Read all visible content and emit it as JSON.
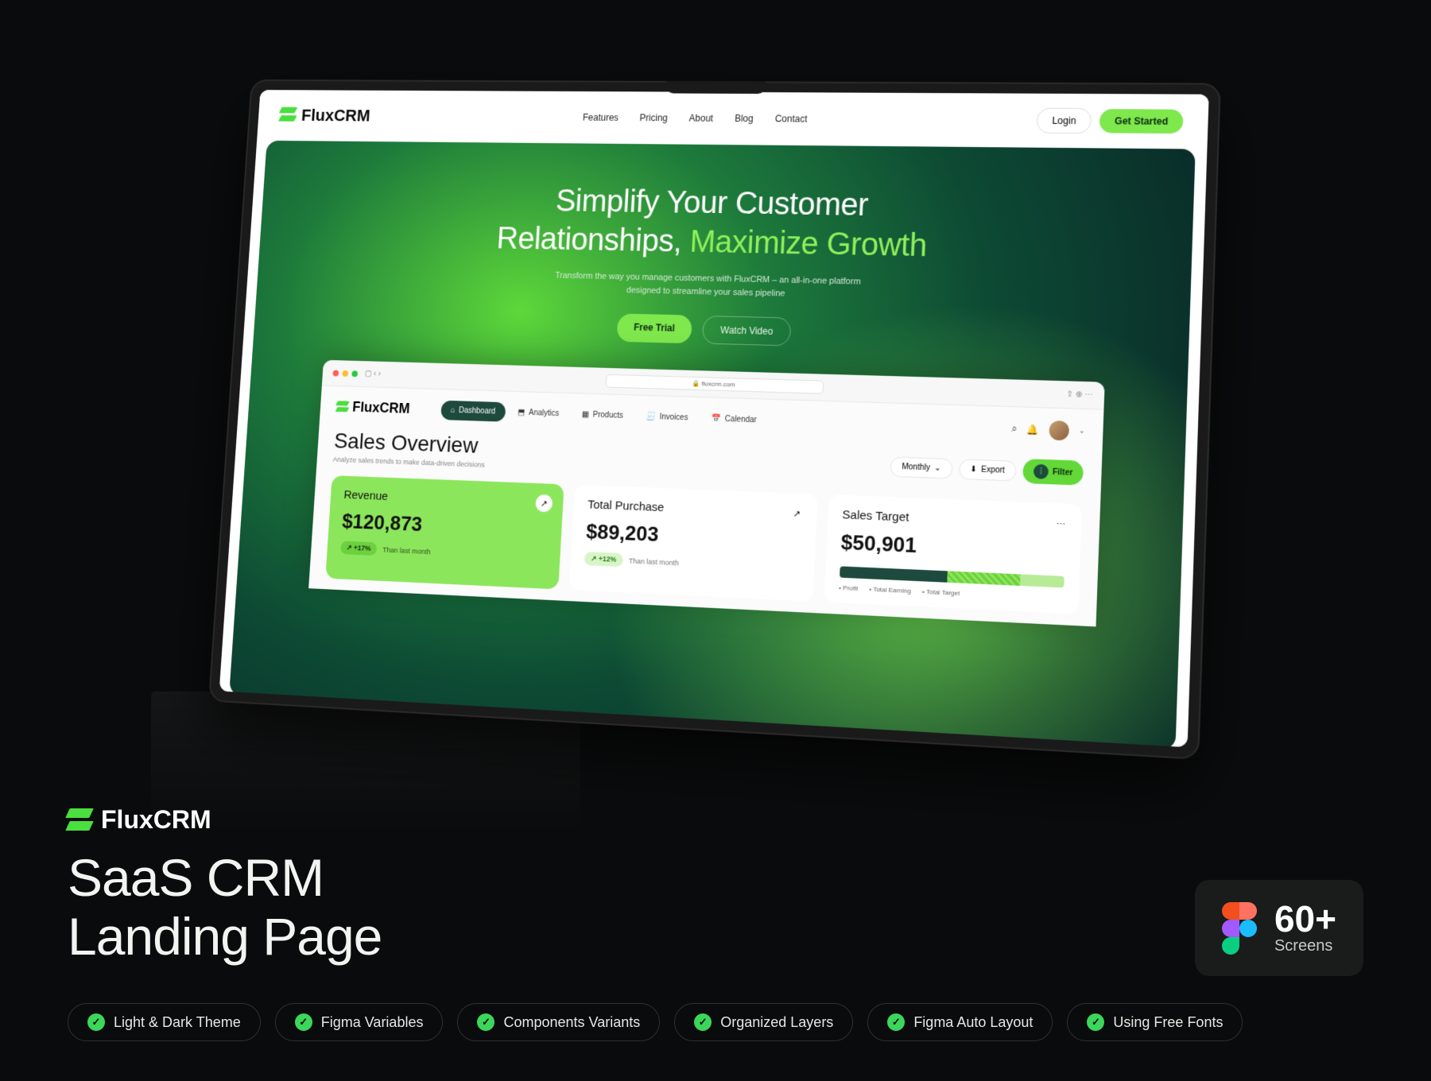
{
  "brand": "FluxCRM",
  "nav": {
    "links": [
      "Features",
      "Pricing",
      "About",
      "Blog",
      "Contact"
    ],
    "login": "Login",
    "cta": "Get Started"
  },
  "hero": {
    "title_a": "Simplify Your Customer",
    "title_b": "Relationships, ",
    "title_accent": "Maximize Growth",
    "subtitle": "Transform the way you manage customers with FluxCRM – an all-in-one platform\ndesigned to streamline your sales pipeline",
    "cta_primary": "Free Trial",
    "cta_secondary": "Watch Video"
  },
  "browser": {
    "url": "fluxcrm.com"
  },
  "dashboard": {
    "nav": [
      "Dashboard",
      "Analytics",
      "Products",
      "Invoices",
      "Calendar"
    ],
    "title": "Sales Overview",
    "subtitle": "Analyze sales trends to make data-driven decisions",
    "period": "Monthly",
    "export": "Export",
    "filter": "Filter",
    "cards": {
      "revenue": {
        "label": "Revenue",
        "value": "$120,873",
        "delta": "+17%",
        "note": "Than last month"
      },
      "purchase": {
        "label": "Total Purchase",
        "value": "$89,203",
        "delta": "+12%",
        "note": "Than last month"
      },
      "target": {
        "label": "Sales Target",
        "value": "$50,901",
        "legend": [
          "Profit",
          "Total Earning",
          "Total Target"
        ]
      }
    }
  },
  "promo": {
    "title_a": "SaaS CRM",
    "title_b": "Landing Page",
    "screens_num": "60+",
    "screens_label": "Screens",
    "features": [
      "Light & Dark Theme",
      "Figma Variables",
      "Components Variants",
      "Organized Layers",
      "Figma Auto Layout",
      "Using Free Fonts"
    ]
  }
}
